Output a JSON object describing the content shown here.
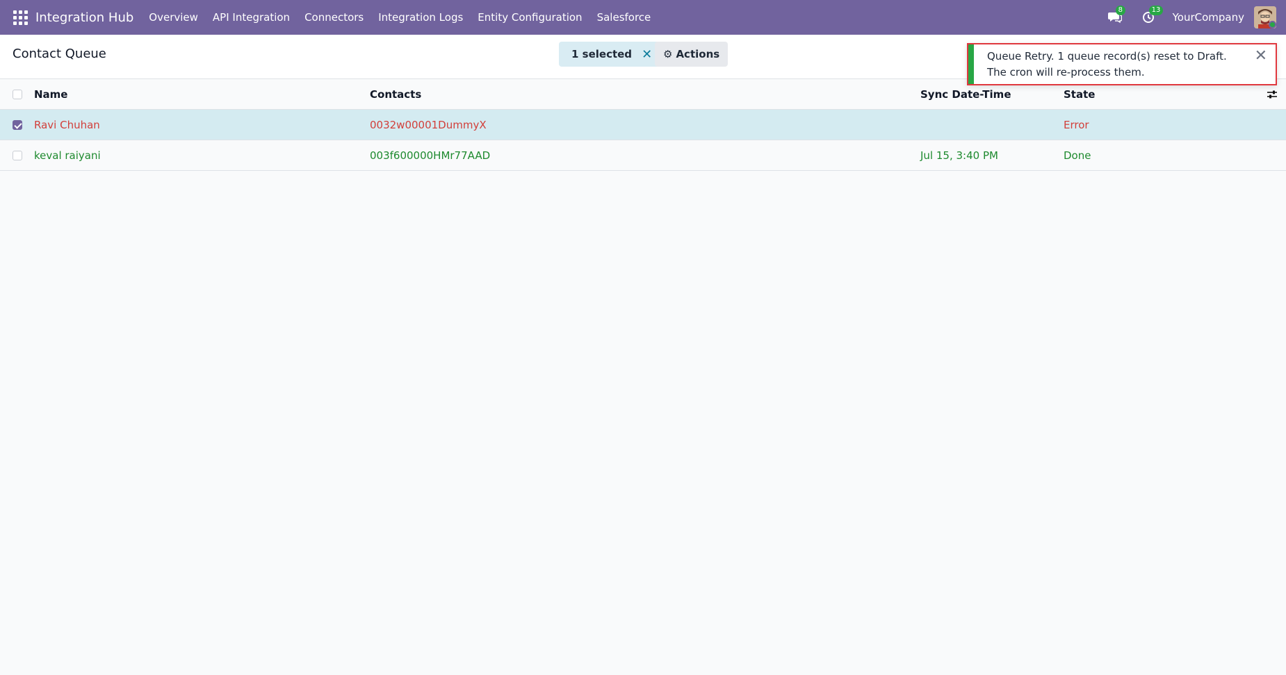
{
  "navbar": {
    "brand": "Integration Hub",
    "menu": [
      "Overview",
      "API Integration",
      "Connectors",
      "Integration Logs",
      "Entity Configuration",
      "Salesforce"
    ],
    "messages_count": "8",
    "activities_count": "13",
    "company": "YourCompany"
  },
  "control_panel": {
    "title": "Contact Queue",
    "selected_label": "1 selected",
    "actions_label": "Actions"
  },
  "table": {
    "headers": {
      "name": "Name",
      "contacts": "Contacts",
      "sync": "Sync Date-Time",
      "state": "State"
    },
    "rows": [
      {
        "name": "Ravi Chuhan",
        "contacts": "0032w00001DummyX",
        "sync": "",
        "state": "Error",
        "checked": true
      },
      {
        "name": "keval raiyani",
        "contacts": "003f600000HMr77AAD",
        "sync": "Jul 15, 3:40 PM",
        "state": "Done",
        "checked": false
      }
    ]
  },
  "notification": {
    "message": "Queue Retry. 1 queue record(s) reset to Draft. The cron will re-process them."
  },
  "colors": {
    "navbar": "#71639e",
    "error_text": "#d23f3a",
    "done_text": "#1e8a2e",
    "selected_row": "#d4ebf1",
    "success": "#28a745"
  }
}
